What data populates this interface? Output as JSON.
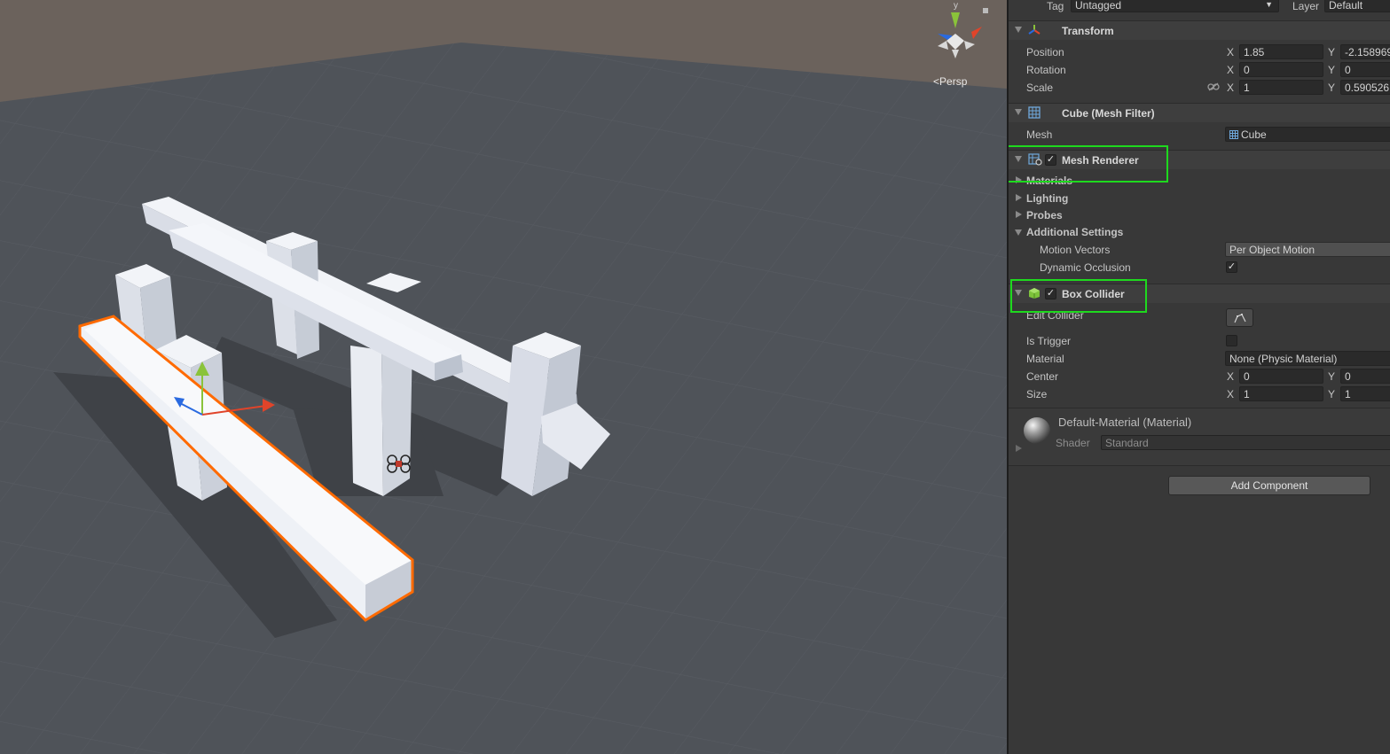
{
  "scene": {
    "view_mode": "Persp",
    "gizmo_axis_label": "y"
  },
  "inspector": {
    "tag_label": "Tag",
    "tag_value": "Untagged",
    "layer_label": "Layer",
    "layer_value": "Default",
    "transform": {
      "title": "Transform",
      "position_label": "Position",
      "position_x": "1.85",
      "position_y": "-2.158969",
      "rotation_label": "Rotation",
      "rotation_x": "0",
      "rotation_y": "0",
      "scale_label": "Scale",
      "scale_x": "1",
      "scale_y": "0.590526"
    },
    "mesh_filter": {
      "title": "Cube (Mesh Filter)",
      "mesh_label": "Mesh",
      "mesh_value": "Cube"
    },
    "mesh_renderer": {
      "title": "Mesh Renderer",
      "enabled": true,
      "materials_label": "Materials",
      "lighting_label": "Lighting",
      "probes_label": "Probes",
      "additional_label": "Additional Settings",
      "motion_vectors_label": "Motion Vectors",
      "motion_vectors_value": "Per Object Motion",
      "dynamic_occlusion_label": "Dynamic Occlusion",
      "dynamic_occlusion": true
    },
    "box_collider": {
      "title": "Box Collider",
      "enabled": true,
      "edit_collider_label": "Edit Collider",
      "is_trigger_label": "Is Trigger",
      "is_trigger": false,
      "material_label": "Material",
      "material_value": "None (Physic Material)",
      "center_label": "Center",
      "center_x": "0",
      "center_y": "0",
      "size_label": "Size",
      "size_x": "1",
      "size_y": "1"
    },
    "material": {
      "name": "Default-Material (Material)",
      "shader_label": "Shader",
      "shader_value": "Standard"
    },
    "add_component_label": "Add Component",
    "axis_x": "X",
    "axis_y": "Y"
  },
  "colors": {
    "highlight": "#1ed91e",
    "selection_outline": "#ff6a00"
  }
}
